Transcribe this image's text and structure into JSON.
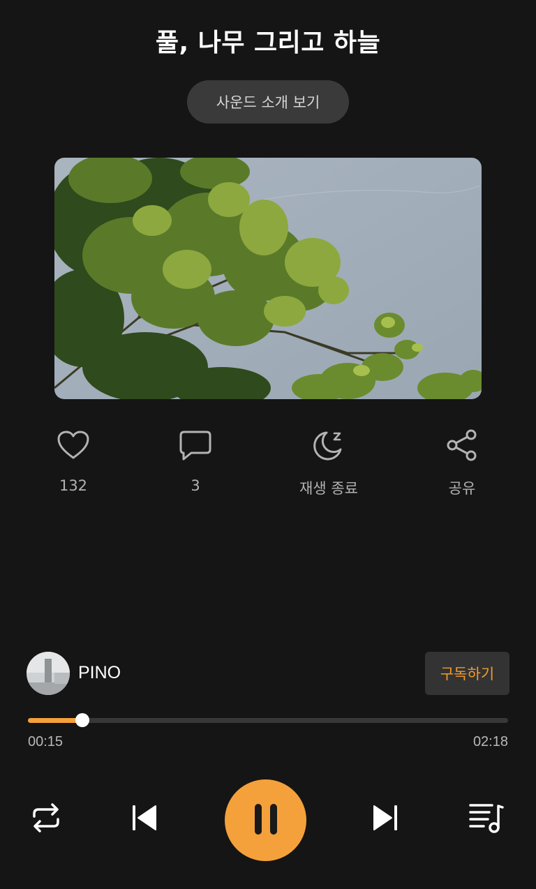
{
  "track": {
    "title": "풀, 나무 그리고 하늘",
    "intro_button": "사운드 소개 보기"
  },
  "actions": {
    "like": {
      "icon": "heart-icon",
      "label": "132"
    },
    "comment": {
      "icon": "comment-icon",
      "label": "3"
    },
    "sleep_timer": {
      "icon": "moon-icon",
      "label": "재생 종료"
    },
    "share": {
      "icon": "share-icon",
      "label": "공유"
    }
  },
  "creator": {
    "name": "PINO",
    "subscribe_label": "구독하기"
  },
  "playback": {
    "current_time": "00:15",
    "total_time": "02:18",
    "progress_fraction": 0.114
  },
  "controls": {
    "repeat": "repeat-icon",
    "previous": "skip-previous-icon",
    "play_pause": "pause-icon",
    "next": "skip-next-icon",
    "playlist": "playlist-icon"
  },
  "colors": {
    "background": "#151515",
    "accent": "#f5a13b",
    "subscribe_text": "#f39a2e"
  }
}
